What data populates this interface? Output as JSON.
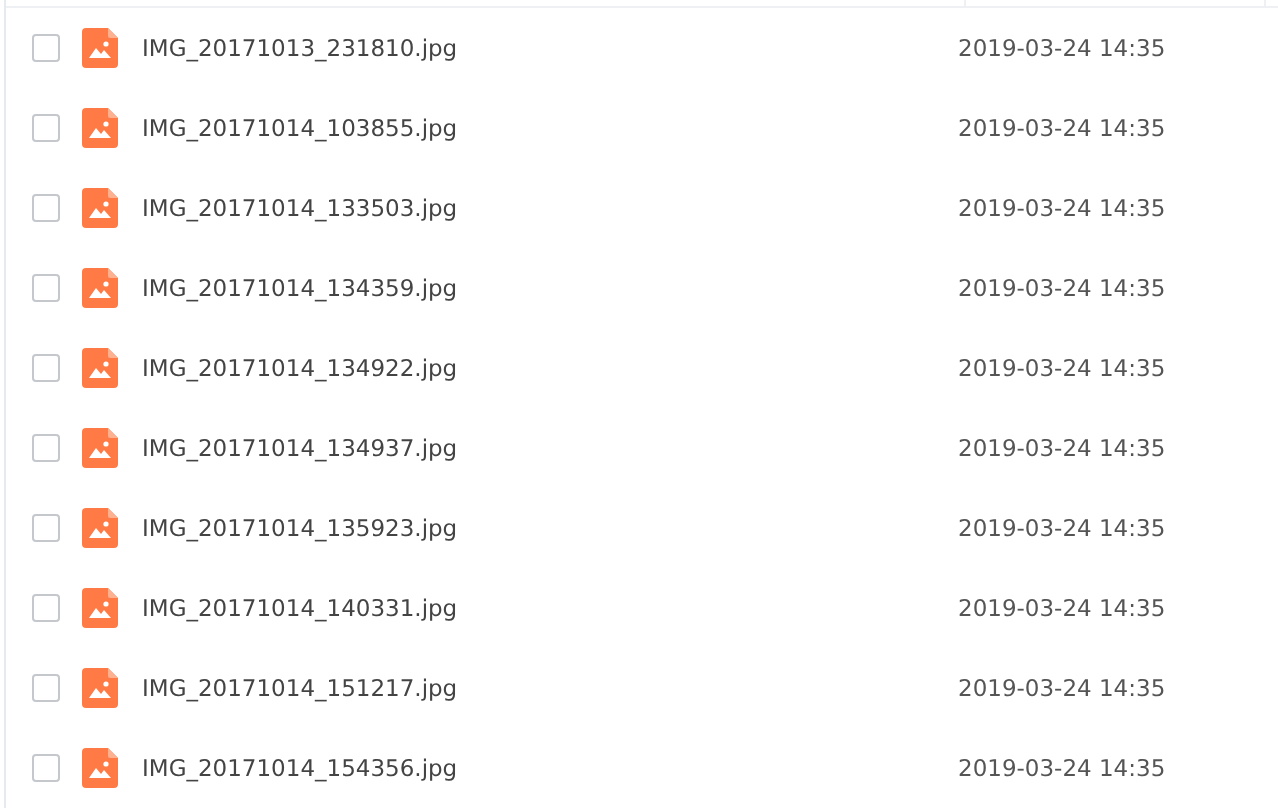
{
  "files": [
    {
      "name": "IMG_20171013_231810.jpg",
      "date": "2019-03-24 14:35",
      "checked": false
    },
    {
      "name": "IMG_20171014_103855.jpg",
      "date": "2019-03-24 14:35",
      "checked": false
    },
    {
      "name": "IMG_20171014_133503.jpg",
      "date": "2019-03-24 14:35",
      "checked": false
    },
    {
      "name": "IMG_20171014_134359.jpg",
      "date": "2019-03-24 14:35",
      "checked": false
    },
    {
      "name": "IMG_20171014_134922.jpg",
      "date": "2019-03-24 14:35",
      "checked": false
    },
    {
      "name": "IMG_20171014_134937.jpg",
      "date": "2019-03-24 14:35",
      "checked": false
    },
    {
      "name": "IMG_20171014_135923.jpg",
      "date": "2019-03-24 14:35",
      "checked": false
    },
    {
      "name": "IMG_20171014_140331.jpg",
      "date": "2019-03-24 14:35",
      "checked": false
    },
    {
      "name": "IMG_20171014_151217.jpg",
      "date": "2019-03-24 14:35",
      "checked": false
    },
    {
      "name": "IMG_20171014_154356.jpg",
      "date": "2019-03-24 14:35",
      "checked": false
    }
  ]
}
